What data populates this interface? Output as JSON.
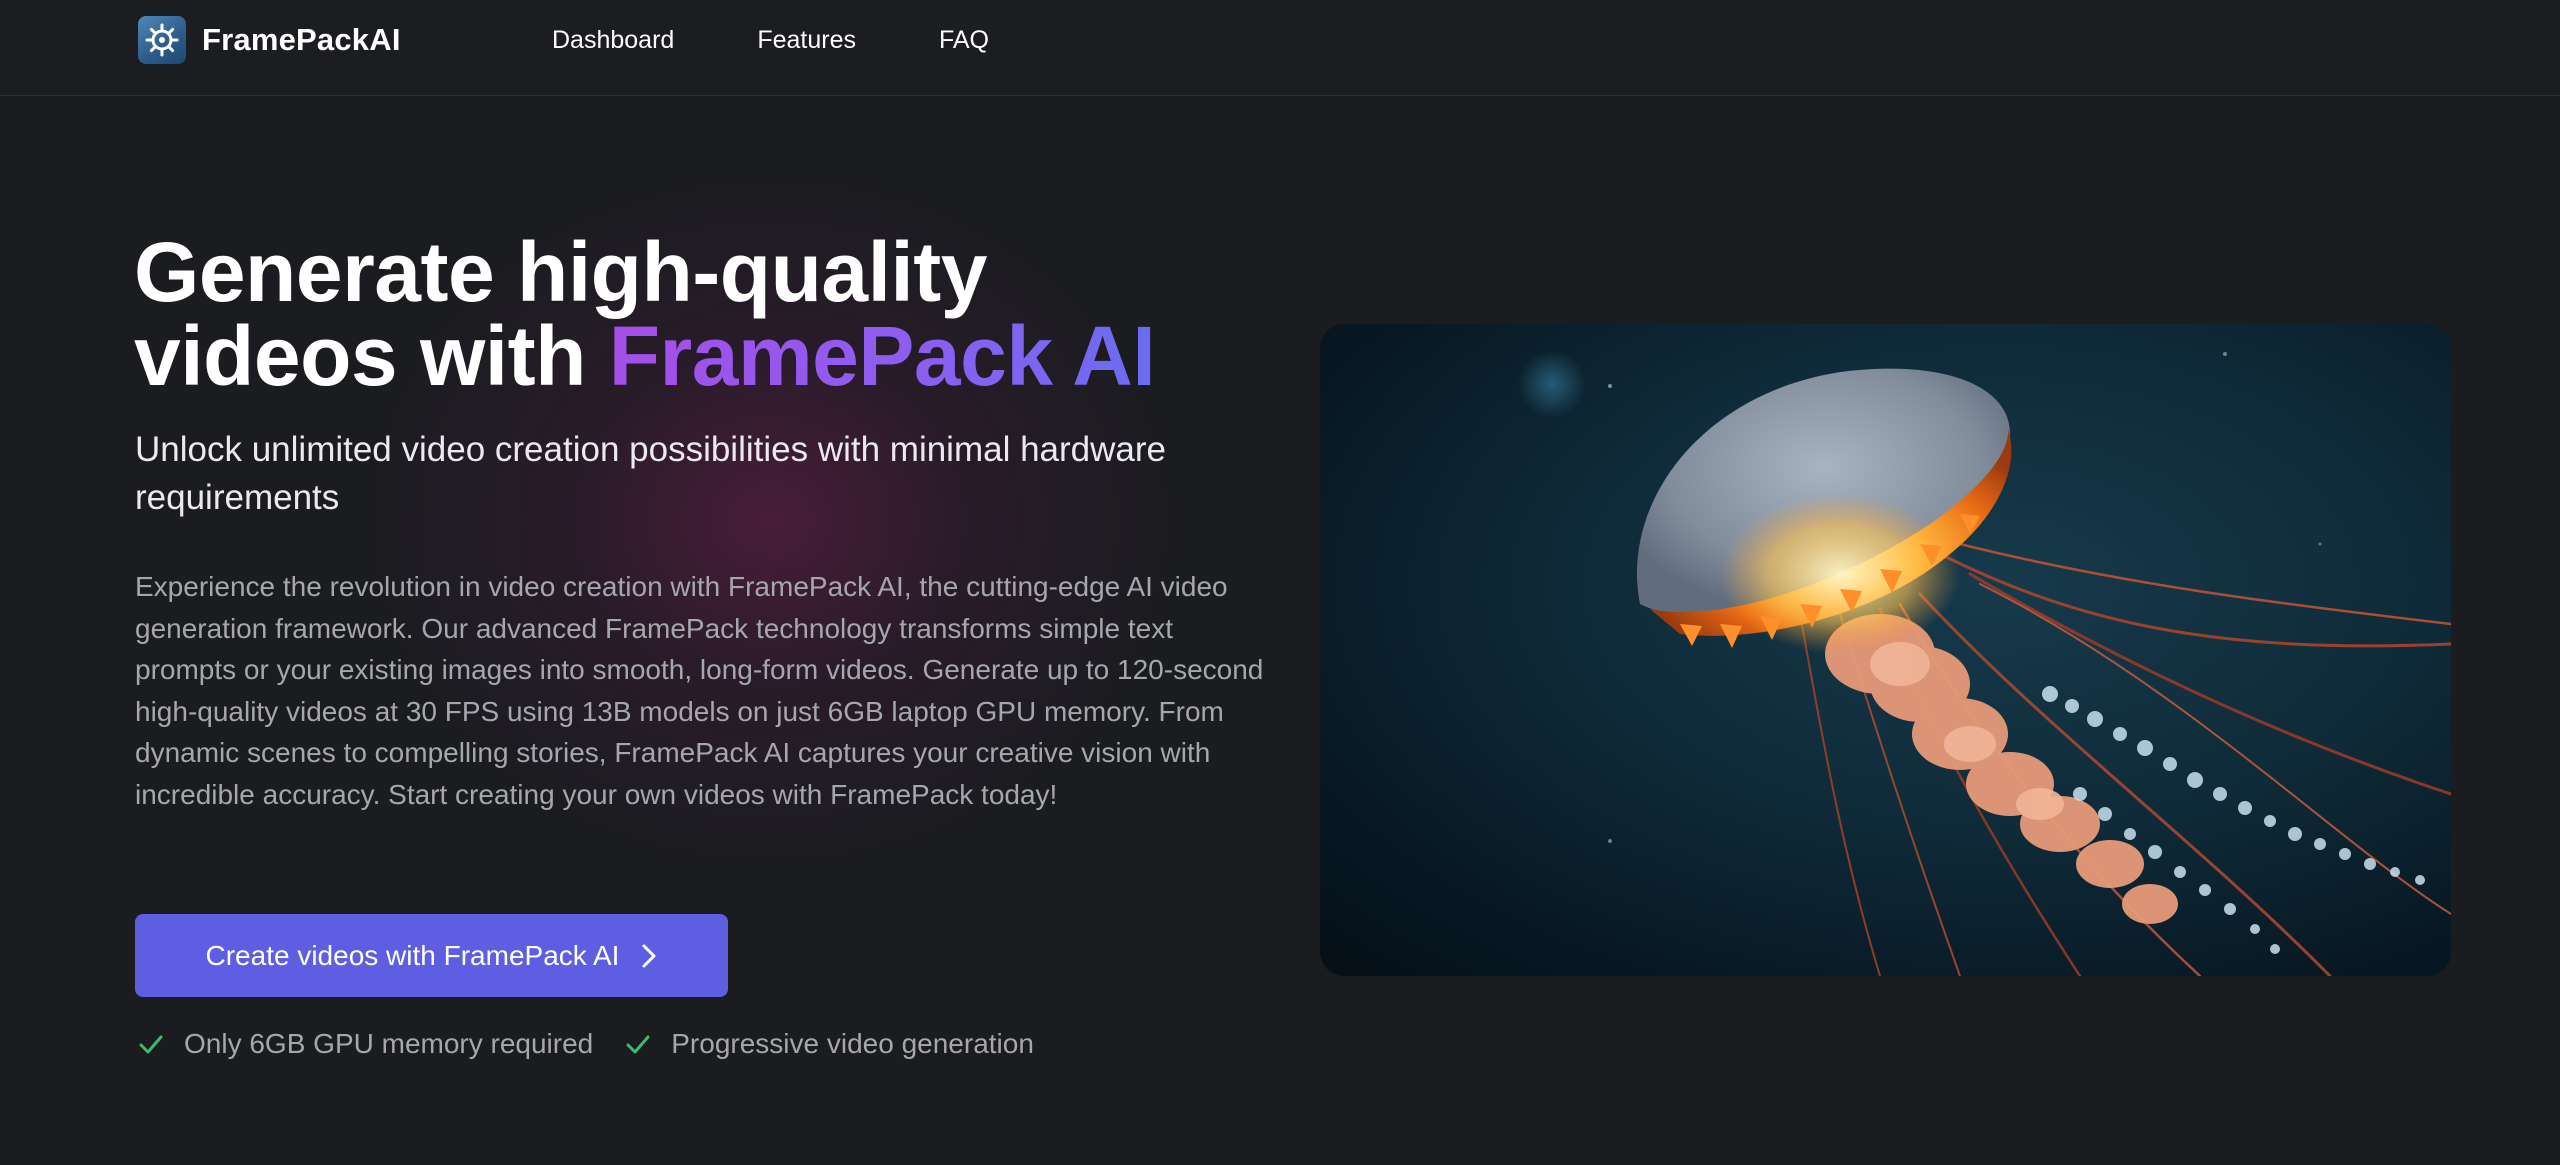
{
  "header": {
    "brand": {
      "name": "FramePackAI",
      "logo_icon": "ship-wheel-icon"
    },
    "nav": [
      {
        "label": "Dashboard"
      },
      {
        "label": "Features"
      },
      {
        "label": "FAQ"
      }
    ]
  },
  "hero": {
    "title_line1": "Generate high-quality",
    "title_line2_prefix": "videos with ",
    "title_line2_accent": "FramePack AI",
    "subtitle": "Unlock unlimited video creation possibilities with minimal hardware requirements",
    "description": "Experience the revolution in video creation with FramePack AI, the cutting-edge AI video generation framework. Our advanced FramePack technology transforms simple text prompts or your existing images into smooth, long-form videos. Generate up to 120-second high-quality videos at 30 FPS using 13B models on just 6GB laptop GPU memory. From dynamic scenes to compelling stories, FramePack AI captures your creative vision with incredible accuracy. Start creating your own videos with FramePack today!",
    "cta": {
      "label": "Create videos with FramePack AI",
      "icon": "chevron-right-icon"
    },
    "features": [
      {
        "label": "Only 6GB GPU memory required",
        "icon": "check-icon"
      },
      {
        "label": "Progressive video generation",
        "icon": "check-icon"
      }
    ]
  },
  "media": {
    "subject": "jellyfish-image"
  },
  "colors": {
    "background": "#1b1c20",
    "accent_gradient_start": "#a54fe8",
    "accent_gradient_end": "#6a6df0",
    "cta_background": "#5e5ee3",
    "check_color": "#3fb96a",
    "muted_text": "#a6a6ad"
  }
}
